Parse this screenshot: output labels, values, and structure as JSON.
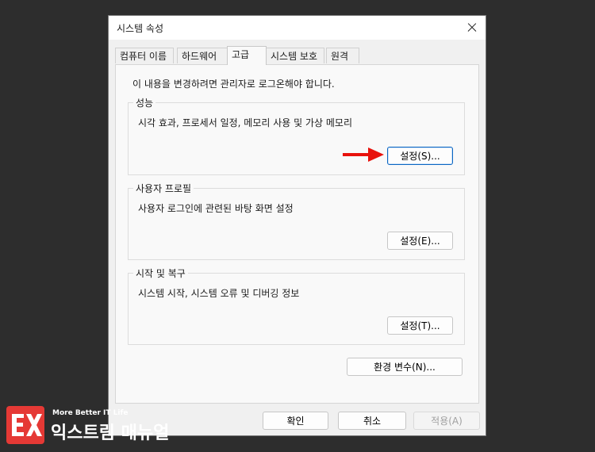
{
  "window": {
    "title": "시스템 속성",
    "close_icon": "close-icon"
  },
  "tabs": [
    {
      "label": "컴퓨터 이름",
      "active": false
    },
    {
      "label": "하드웨어",
      "active": false
    },
    {
      "label": "고급",
      "active": true
    },
    {
      "label": "시스템 보호",
      "active": false
    },
    {
      "label": "원격",
      "active": false
    }
  ],
  "admin_note": "이 내용을 변경하려면 관리자로 로그온해야 합니다.",
  "groups": {
    "performance": {
      "label": "성능",
      "description": "시각 효과, 프로세서 일정, 메모리 사용 및 가상 메모리",
      "button": "설정(S)..."
    },
    "profiles": {
      "label": "사용자 프로필",
      "description": "사용자 로그인에 관련된 바탕 화면 설정",
      "button": "설정(E)..."
    },
    "startup": {
      "label": "시작 및 복구",
      "description": "시스템 시작, 시스템 오류 및 디버깅 정보",
      "button": "설정(T)..."
    }
  },
  "env_button": "환경 변수(N)...",
  "footer": {
    "ok": "확인",
    "cancel": "취소",
    "apply": "적용(A)"
  },
  "annotation": {
    "arrow_color": "#e8120c",
    "icon": "arrow-right-icon"
  },
  "watermark": {
    "tag": "More Better IT Life",
    "name": "익스트림 매뉴얼",
    "logo_icon": "ex-logo-icon",
    "brand_color": "#e53935"
  }
}
